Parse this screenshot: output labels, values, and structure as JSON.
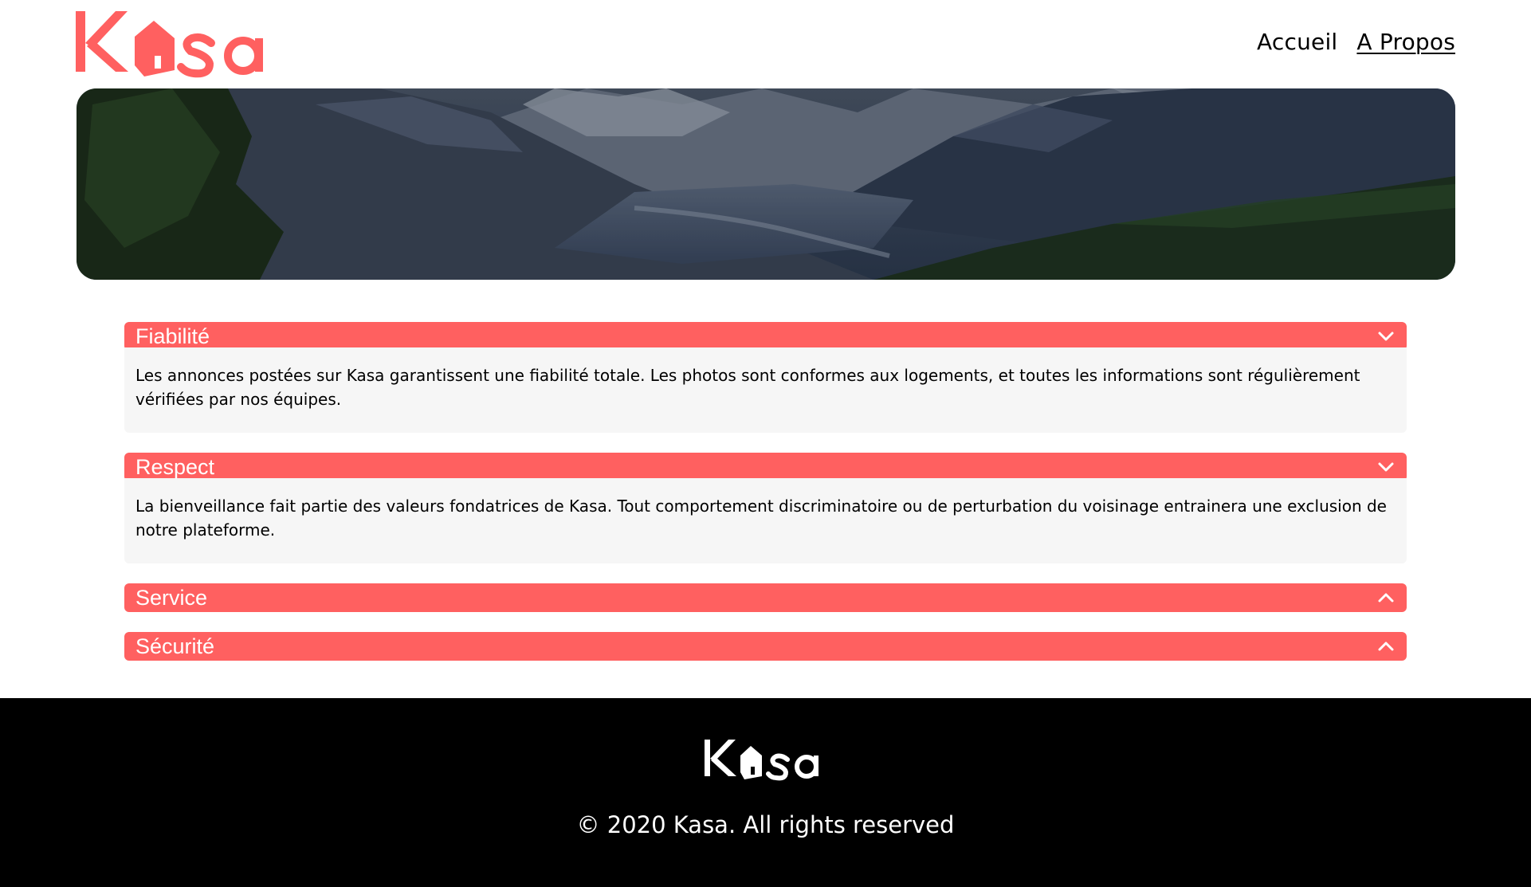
{
  "header": {
    "logo_alt": "Kasa",
    "nav": [
      {
        "label": "Accueil",
        "active": false
      },
      {
        "label": "A Propos",
        "active": true
      }
    ]
  },
  "brand_color": "#ff6060",
  "sections": [
    {
      "title": "Fiabilité",
      "expanded": true,
      "text": "Les annonces postées sur Kasa garantissent une fiabilité totale. Les photos sont conformes aux logements, et toutes les informations sont régulièrement vérifiées par nos équipes."
    },
    {
      "title": "Respect",
      "expanded": true,
      "text": "La bienveillance fait partie des valeurs fondatrices de Kasa. Tout comportement discriminatoire ou de perturbation du voisinage entrainera une exclusion de notre plateforme."
    },
    {
      "title": "Service",
      "expanded": false,
      "text": ""
    },
    {
      "title": "Sécurité",
      "expanded": false,
      "text": ""
    }
  ],
  "footer": {
    "copyright": "© 2020 Kasa. All rights reserved"
  },
  "icons": {
    "expanded": "chevron-down-icon",
    "collapsed": "chevron-up-icon",
    "logo": "house-icon"
  }
}
